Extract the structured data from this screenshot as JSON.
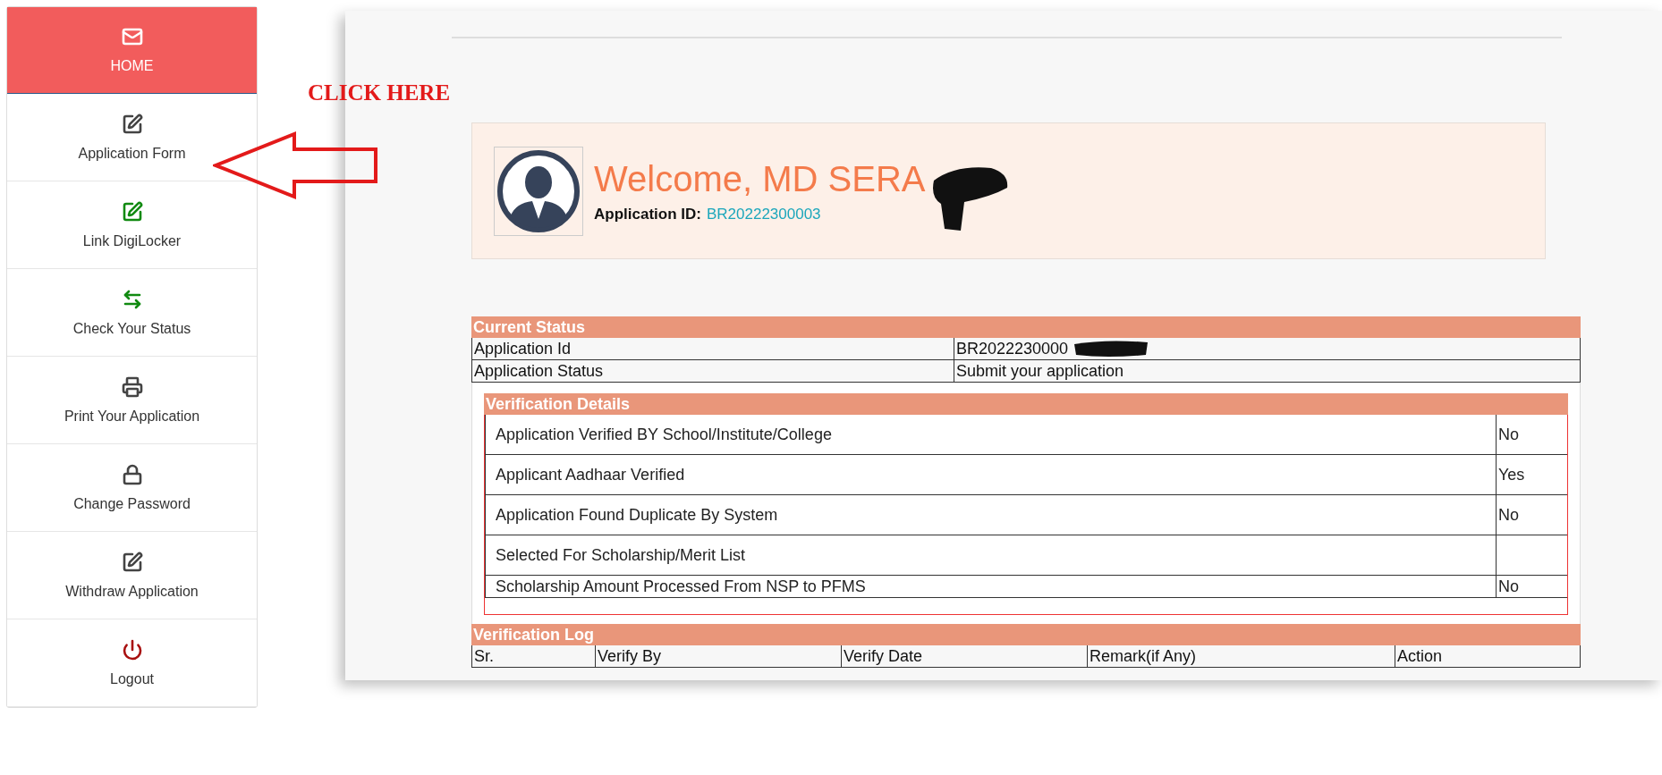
{
  "sidebar": {
    "items": [
      {
        "label": "HOME",
        "selected": true,
        "color": "#ffffff"
      },
      {
        "label": "Application Form",
        "selected": false,
        "color": "#444444"
      },
      {
        "label": "Link DigiLocker",
        "selected": false,
        "color": "#118a11"
      },
      {
        "label": "Check Your Status",
        "selected": false,
        "color": "#118a11"
      },
      {
        "label": "Print Your Application",
        "selected": false,
        "color": "#444444"
      },
      {
        "label": "Change Password",
        "selected": false,
        "color": "#444444"
      },
      {
        "label": "Withdraw Application",
        "selected": false,
        "color": "#444444"
      },
      {
        "label": "Logout",
        "selected": false,
        "color": "#a80f0f"
      }
    ]
  },
  "annotation": {
    "text": "CLICK HERE"
  },
  "welcome": {
    "greeting": "Welcome, MD SERA",
    "id_label": "Application ID:",
    "id_value": "BR20222300003"
  },
  "current_status": {
    "title": "Current Status",
    "rows": [
      [
        "Application Id",
        "BR2022230000"
      ],
      [
        "Application Status",
        "Submit your application"
      ]
    ]
  },
  "verification_details": {
    "title": "Verification Details",
    "rows": [
      [
        "Application Verified BY School/Institute/College",
        "No"
      ],
      [
        "Applicant Aadhaar Verified",
        "Yes"
      ],
      [
        "Application Found Duplicate By System",
        "No"
      ],
      [
        "Selected For Scholarship/Merit List",
        ""
      ],
      [
        "Scholarship Amount Processed From NSP to PFMS",
        "No"
      ]
    ]
  },
  "verification_log": {
    "title": "Verification Log",
    "columns": [
      "Sr.",
      "Verify By",
      "Verify Date",
      "Remark(if Any)",
      "Action"
    ]
  }
}
